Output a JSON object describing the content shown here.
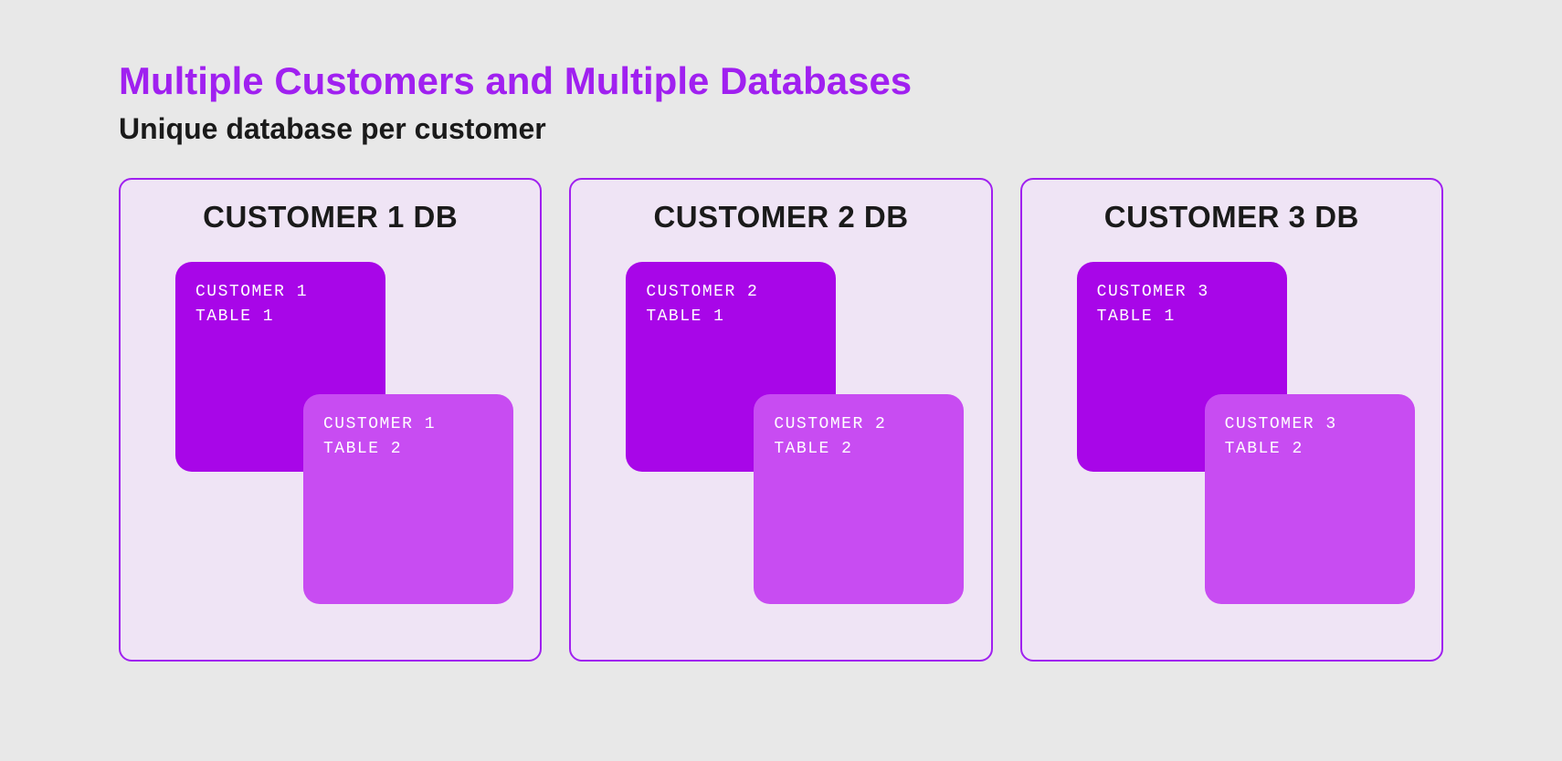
{
  "title": "Multiple Customers and Multiple Databases",
  "subtitle": "Unique database per customer",
  "databases": [
    {
      "name": "CUSTOMER 1 DB",
      "table1_line1": "CUSTOMER 1",
      "table1_line2": "TABLE 1",
      "table2_line1": "CUSTOMER 1",
      "table2_line2": "TABLE 2"
    },
    {
      "name": "CUSTOMER 2 DB",
      "table1_line1": "CUSTOMER 2",
      "table1_line2": "TABLE 1",
      "table2_line1": "CUSTOMER 2",
      "table2_line2": "TABLE 2"
    },
    {
      "name": "CUSTOMER 3 DB",
      "table1_line1": "CUSTOMER 3",
      "table1_line2": "TABLE 1",
      "table2_line1": "CUSTOMER 3",
      "table2_line2": "TABLE 2"
    }
  ]
}
